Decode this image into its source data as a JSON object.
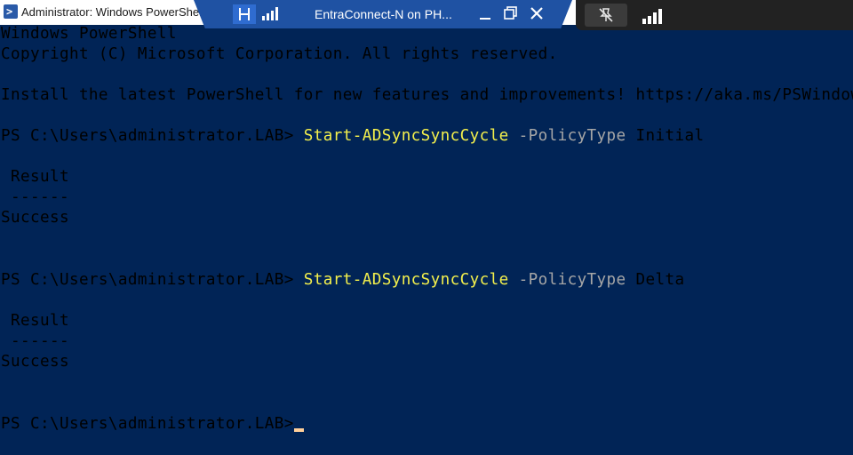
{
  "window": {
    "title": "Administrator: Windows PowerShell",
    "icon": "powershell-icon"
  },
  "remote_bar": {
    "connection_name": "EntraConnect-N on PH...",
    "pin_icon": "pin-icon",
    "signal_icon": "signal-strength-icon",
    "minimize_icon": "minimize-icon",
    "restore_icon": "restore-icon",
    "close_icon": "close-icon",
    "background": "#1f52a3"
  },
  "overlay_bar": {
    "unpin_icon": "unpin-icon",
    "signal_icon": "signal-strength-icon",
    "background": "#222222"
  },
  "console": {
    "background": "#012456",
    "header_line1": "Windows PowerShell",
    "header_line2": "Copyright (C) Microsoft Corporation. All rights reserved.",
    "install_msg": "Install the latest PowerShell for new features and improvements! https://aka.ms/PSWindows",
    "commands": [
      {
        "prompt": "PS C:\\Users\\administrator.LAB> ",
        "cmdlet": "Start-ADSyncSyncCycle",
        "param": "-PolicyType",
        "value": "Initial",
        "result_header": " Result",
        "result_divider": " ------",
        "result_value": "Success"
      },
      {
        "prompt": "PS C:\\Users\\administrator.LAB> ",
        "cmdlet": "Start-ADSyncSyncCycle",
        "param": "-PolicyType",
        "value": "Delta",
        "result_header": " Result",
        "result_divider": " ------",
        "result_value": "Success"
      }
    ],
    "final_prompt": "PS C:\\Users\\administrator.LAB> "
  }
}
